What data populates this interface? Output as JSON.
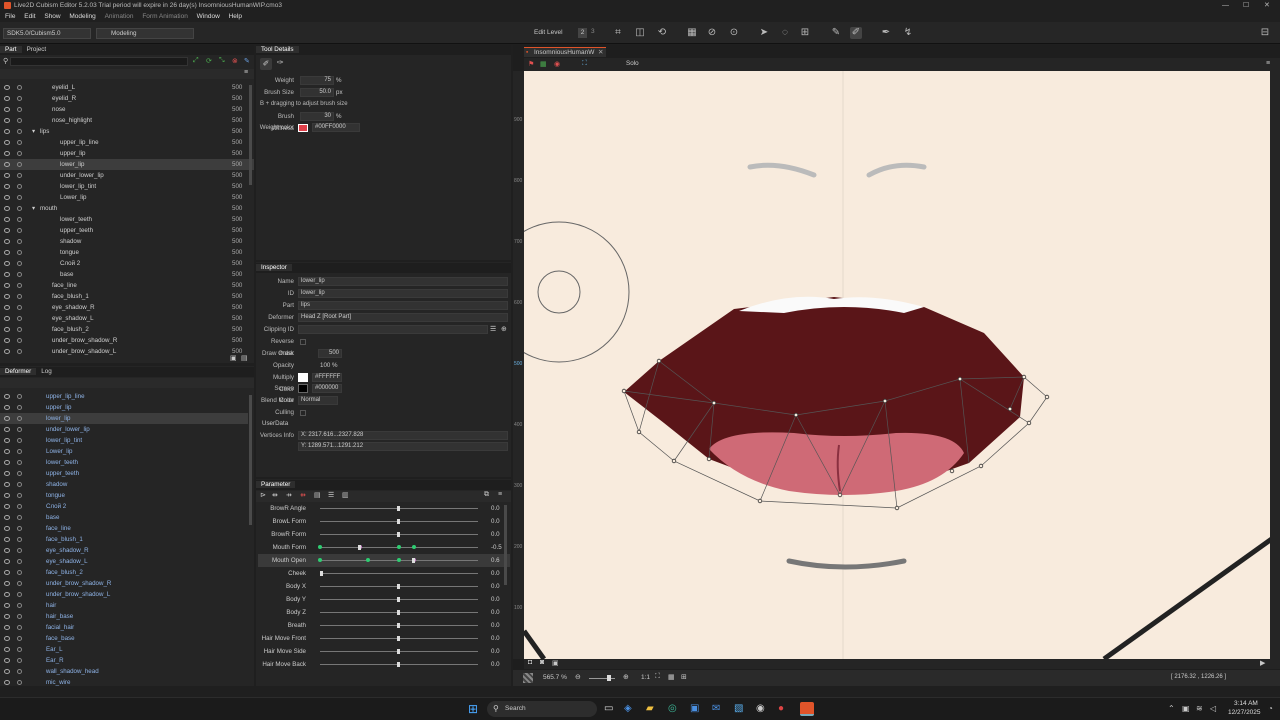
{
  "title": {
    "text": "Live2D Cubism Editor 5.2.03   Trial period will expire in 26 day(s)   InsomniousHumanWIP.cmo3",
    "min": "—",
    "max": "☐",
    "close": "✕"
  },
  "menu": [
    "File",
    "Edit",
    "Show",
    "Modeling",
    "Animation",
    "Form Animation",
    "Window",
    "Help"
  ],
  "toolbar": {
    "sdk": "SDK5.0/Cubism5.0",
    "mode": "Modeling",
    "edit_level": "Edit Level",
    "lvl1": "1",
    "lvl2": "2",
    "lvl3": "3"
  },
  "part_panel": {
    "tabs": [
      "Part",
      "Project"
    ],
    "rows": [
      {
        "name": "eyelid_L",
        "num": "500"
      },
      {
        "name": "eyelid_R",
        "num": "500"
      },
      {
        "name": "nose",
        "num": "500"
      },
      {
        "name": "nose_highlight",
        "num": "500"
      },
      {
        "name": "lips",
        "num": "500"
      },
      {
        "name": "upper_lip_line",
        "num": "500"
      },
      {
        "name": "upper_lip",
        "num": "500"
      },
      {
        "name": "lower_lip",
        "num": "500"
      },
      {
        "name": "under_lower_lip",
        "num": "500"
      },
      {
        "name": "lower_lip_tint",
        "num": "500"
      },
      {
        "name": "Lower_lip",
        "num": "500"
      },
      {
        "name": "mouth",
        "num": "500"
      },
      {
        "name": "lower_teeth",
        "num": "500"
      },
      {
        "name": "upper_teeth",
        "num": "500"
      },
      {
        "name": "shadow",
        "num": "500"
      },
      {
        "name": "tongue",
        "num": "500"
      },
      {
        "name": "Слой 2",
        "num": "500"
      },
      {
        "name": "base",
        "num": "500"
      },
      {
        "name": "face_line",
        "num": "500"
      },
      {
        "name": "face_blush_1",
        "num": "500"
      },
      {
        "name": "eye_shadow_R",
        "num": "500"
      },
      {
        "name": "eye_shadow_L",
        "num": "500"
      },
      {
        "name": "face_blush_2",
        "num": "500"
      },
      {
        "name": "under_brow_shadow_R",
        "num": "500"
      },
      {
        "name": "under_brow_shadow_L",
        "num": "500"
      }
    ]
  },
  "deformer_panel": {
    "tabs": [
      "Deformer",
      "Log"
    ],
    "rows": [
      "upper_lip_line",
      "upper_lip",
      "lower_lip",
      "under_lower_lip",
      "lower_lip_tint",
      "Lower_lip",
      "lower_teeth",
      "upper_teeth",
      "shadow",
      "tongue",
      "Слой 2",
      "base",
      "face_line",
      "face_blush_1",
      "eye_shadow_R",
      "eye_shadow_L",
      "face_blush_2",
      "under_brow_shadow_R",
      "under_brow_shadow_L",
      "hair",
      "hair_base",
      "facial_hair",
      "face_base",
      "Ear_L",
      "Ear_R",
      "wall_shadow_head",
      "mic_wire"
    ]
  },
  "tool_details": {
    "title": "Tool Details",
    "weight_label": "Weight",
    "weight": "75",
    "pct": "%",
    "brush_label": "Brush Size",
    "brush": "50.0",
    "px": "px",
    "hint": "B + dragging to adjust brush size",
    "stiff_label": "Brush stiffness",
    "stiff": "30",
    "wc_label": "Weight color",
    "wc": "#00FF0000"
  },
  "inspector": {
    "title": "Inspector",
    "name_l": "Name",
    "name": "lower_lip",
    "id_l": "ID",
    "id": "lower_lip",
    "part_l": "Part",
    "part": "lips",
    "def_l": "Deformer",
    "def": "Head Z  [Root Part]",
    "clip_l": "Clipping ID",
    "rev_l": "Reverse mask",
    "draw_l": "Draw Order",
    "draw": "500",
    "op_l": "Opacity",
    "op": "100 %",
    "mul_l": "Multiply Color",
    "mul": "#FFFFFF",
    "scr_l": "Screen Color",
    "scr": "#000000",
    "blend_l": "Blend Mode",
    "blend": "Normal",
    "cull_l": "Culling",
    "ud_l": "UserData",
    "vi_l": "Vertices Info",
    "vx": "X: 2317.616...2327.828",
    "vy": "Y: 1289.571...1291.212"
  },
  "parameter": {
    "title": "Parameter",
    "rows": [
      {
        "name": "BrowR Angle",
        "val": "0.0"
      },
      {
        "name": "BrowL Form",
        "val": "0.0"
      },
      {
        "name": "BrowR Form",
        "val": "0.0"
      },
      {
        "name": "Mouth Form",
        "val": "-0.5"
      },
      {
        "name": "Mouth Open",
        "val": "0.6"
      },
      {
        "name": "Cheek",
        "val": "0.0"
      },
      {
        "name": "Body X",
        "val": "0.0"
      },
      {
        "name": "Body Y",
        "val": "0.0"
      },
      {
        "name": "Body Z",
        "val": "0.0"
      },
      {
        "name": "Breath",
        "val": "0.0"
      },
      {
        "name": "Hair Move Front",
        "val": "0.0"
      },
      {
        "name": "Hair Move Side",
        "val": "0.0"
      },
      {
        "name": "Hair Move Back",
        "val": "0.0"
      }
    ]
  },
  "viewport": {
    "tab": "InsomniousHumanW",
    "solo": "Solo",
    "zoom": "565.7 %",
    "ratio": "1:1",
    "coords": "[ 2176.32 , 1226.26 ]",
    "ruler": [
      "900",
      "800",
      "700",
      "600",
      "500",
      "400",
      "300",
      "200",
      "100"
    ]
  },
  "taskbar": {
    "search": "Search",
    "time": "3:14 AM",
    "date": "12/27/2025"
  }
}
